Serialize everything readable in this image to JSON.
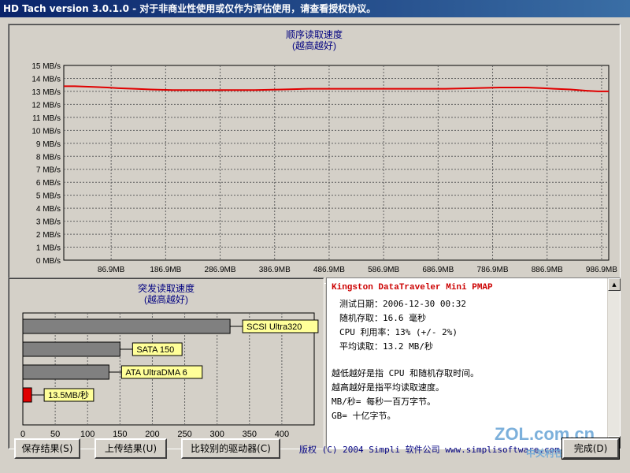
{
  "window": {
    "title": "HD Tach version 3.0.1.0 - 对于非商业性使用或仅作为评估使用，请查看授权协议。"
  },
  "sequential": {
    "title_line1": "顺序读取速度",
    "title_line2": "(越高越好)"
  },
  "burst": {
    "title_line1": "突发读取速度",
    "title_line2": "(越高越好)"
  },
  "info": {
    "device": "Kingston DataTraveler Mini PMAP",
    "lines": [
      "测试日期：2006-12-30    00:32",
      "随机存取：16.6 毫秒",
      "CPU 利用率：13% (+/- 2%)",
      "平均读取：13.2 MB/秒"
    ],
    "notes": [
      "越低越好是指 CPU 和随机存取时间。",
      "越高越好是指平均读取速度。",
      "MB/秒= 每秒一百万字节。",
      "GB= 十亿字节。"
    ]
  },
  "buttons": {
    "save": "保存结果(S)",
    "upload": "上传结果(U)",
    "compare": "比较别的驱动器(C)",
    "done": "完成(D)"
  },
  "footer": {
    "copyright": "版权 (C) 2004 Simpli 软件公司 www.simplisoftware.com"
  },
  "watermark": {
    "logo": "ZOL.com.cn",
    "sub": "中关村在线"
  },
  "colors": {
    "line": "#e00000",
    "bar_gray": "#808080",
    "bar_red": "#e00000",
    "label_bg": "#ffff99"
  },
  "chart_data": [
    {
      "type": "line",
      "title": "顺序读取速度 (越高越好)",
      "ylabel": "",
      "xlabel": "",
      "y_unit": "MB/s",
      "ylim": [
        0,
        15
      ],
      "yticks": [
        0,
        1,
        2,
        3,
        4,
        5,
        6,
        7,
        8,
        9,
        10,
        11,
        12,
        13,
        14,
        15
      ],
      "ytick_labels": [
        "0 MB/s",
        "1 MB/s",
        "2 MB/s",
        "3 MB/s",
        "4 MB/s",
        "5 MB/s",
        "6 MB/s",
        "7 MB/s",
        "8 MB/s",
        "9 MB/s",
        "10 MB/s",
        "11 MB/s",
        "12 MB/s",
        "13 MB/s",
        "14 MB/s",
        "15 MB/s"
      ],
      "xlim": [
        0,
        1000
      ],
      "xticks": [
        86.9,
        186.9,
        286.9,
        386.9,
        486.9,
        586.9,
        686.9,
        786.9,
        886.9,
        986.9
      ],
      "xtick_labels": [
        "86.9MB",
        "186.9MB",
        "286.9MB",
        "386.9MB",
        "486.9MB",
        "586.9MB",
        "686.9MB",
        "786.9MB",
        "886.9MB",
        "986.9MB"
      ],
      "grid": true,
      "series": [
        {
          "x": [
            0,
            20,
            50,
            80,
            100,
            130,
            160,
            200,
            250,
            300,
            350,
            400,
            450,
            500,
            550,
            600,
            650,
            700,
            750,
            800,
            850,
            880,
            900,
            930,
            960,
            980,
            1000
          ],
          "y": [
            13.4,
            13.4,
            13.35,
            13.3,
            13.25,
            13.2,
            13.15,
            13.1,
            13.1,
            13.1,
            13.1,
            13.15,
            13.2,
            13.2,
            13.2,
            13.2,
            13.2,
            13.2,
            13.25,
            13.3,
            13.3,
            13.25,
            13.2,
            13.15,
            13.05,
            13.0,
            13.0
          ]
        }
      ]
    },
    {
      "type": "bar",
      "orientation": "horizontal",
      "title": "突发读取速度 (越高越好)",
      "xlim": [
        0,
        450
      ],
      "xticks": [
        0,
        50,
        100,
        150,
        200,
        250,
        300,
        350,
        400
      ],
      "categories": [
        "SCSI Ultra320",
        "SATA 150",
        "ATA UltraDMA 6",
        "13.5MB/秒"
      ],
      "values": [
        320,
        150,
        133,
        13.5
      ],
      "highlight": [
        false,
        false,
        false,
        true
      ]
    }
  ]
}
